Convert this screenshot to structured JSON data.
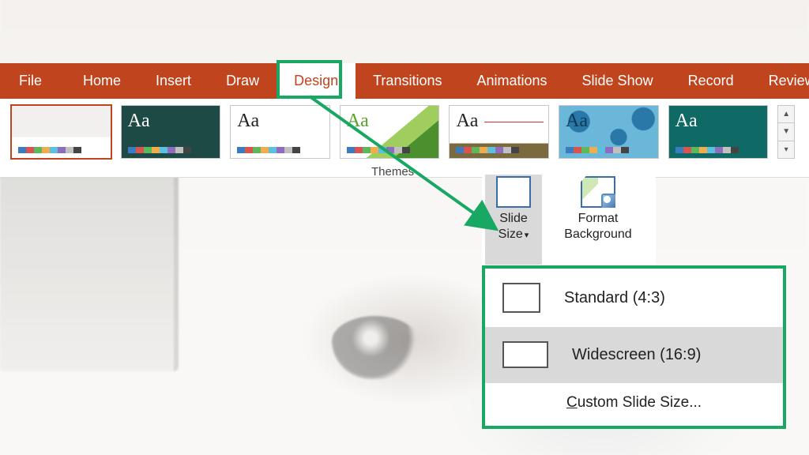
{
  "ribbon": {
    "tabs": [
      {
        "id": "file",
        "label": "File"
      },
      {
        "id": "home",
        "label": "Home"
      },
      {
        "id": "insert",
        "label": "Insert"
      },
      {
        "id": "draw",
        "label": "Draw"
      },
      {
        "id": "design",
        "label": "Design",
        "active": true
      },
      {
        "id": "transitions",
        "label": "Transitions"
      },
      {
        "id": "animations",
        "label": "Animations"
      },
      {
        "id": "slideshow",
        "label": "Slide Show"
      },
      {
        "id": "record",
        "label": "Record"
      },
      {
        "id": "review",
        "label": "Review"
      }
    ]
  },
  "themes": {
    "group_label": "Themes",
    "sample_text": "Aa",
    "palette": [
      "#3b7bbf",
      "#d9534f",
      "#5cb85c",
      "#f0ad4e",
      "#5bc0de",
      "#8e6dbf",
      "#c0c0c0",
      "#444444"
    ]
  },
  "customize": {
    "slide_size": {
      "label_line1": "Slide",
      "label_line2": "Size"
    },
    "format_bg": {
      "label_line1": "Format",
      "label_line2": "Background"
    }
  },
  "slide_size_menu": {
    "standard": "Standard (4:3)",
    "widescreen": "Widescreen (16:9)",
    "custom_prefix": "C",
    "custom_rest": "ustom Slide Size..."
  },
  "annotation": {
    "accent": "#18a864"
  }
}
